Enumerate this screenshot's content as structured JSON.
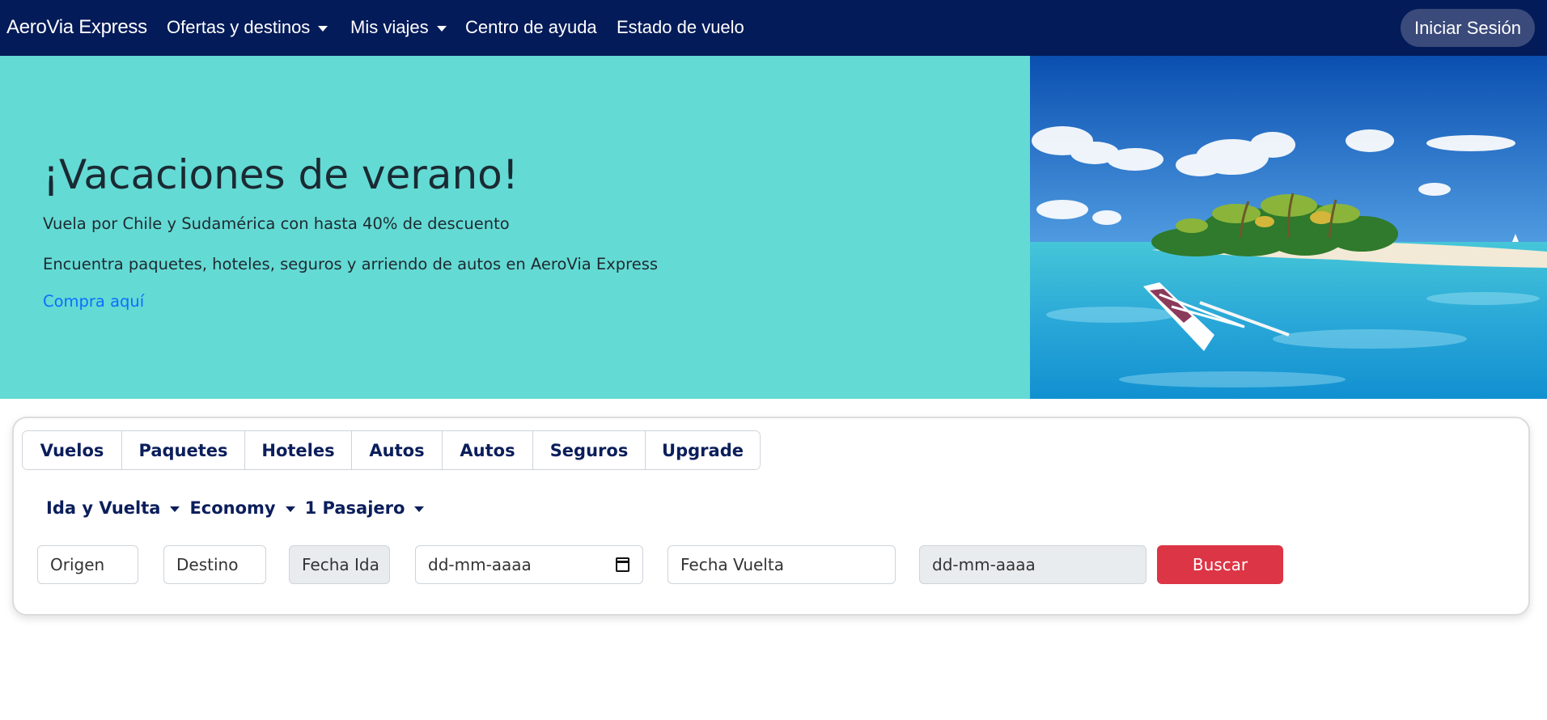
{
  "navbar": {
    "brand": "AeroVia Express",
    "items": [
      {
        "label": "Ofertas y destinos",
        "dropdown": true
      },
      {
        "label": "Mis viajes",
        "dropdown": true
      },
      {
        "label": "Centro de ayuda",
        "dropdown": false
      },
      {
        "label": "Estado de vuelo",
        "dropdown": false
      }
    ],
    "login_label": "Iniciar Sesión"
  },
  "hero": {
    "title": "¡Vacaciones de verano!",
    "subtitle": "Vuela por Chile y Sudamérica con hasta 40% de descuento",
    "description": "Encuentra paquetes, hoteles, seguros y arriendo de autos en AeroVia Express",
    "cta": "Compra aquí",
    "image": "tropical-island-beach-photo"
  },
  "search": {
    "tabs": [
      "Vuelos",
      "Paquetes",
      "Hoteles",
      "Autos",
      "Autos",
      "Seguros",
      "Upgrade"
    ],
    "trip_type": "Ida y Vuelta",
    "cabin_class": "Economy",
    "passengers": "1 Pasajero",
    "fields": {
      "origin_placeholder": "Origen",
      "destination_placeholder": "Destino",
      "departure_label": "Fecha Ida",
      "departure_date_placeholder": "dd-mm-aaaa",
      "return_label": "Fecha Vuelta",
      "return_date_placeholder": "dd-mm-aaaa"
    },
    "search_label": "Buscar"
  },
  "colors": {
    "navbar_bg": "#041b59",
    "hero_bg": "#64dad4",
    "link": "#0d6efd",
    "search_button": "#dc3545",
    "tab_text": "#0b1e5b"
  }
}
